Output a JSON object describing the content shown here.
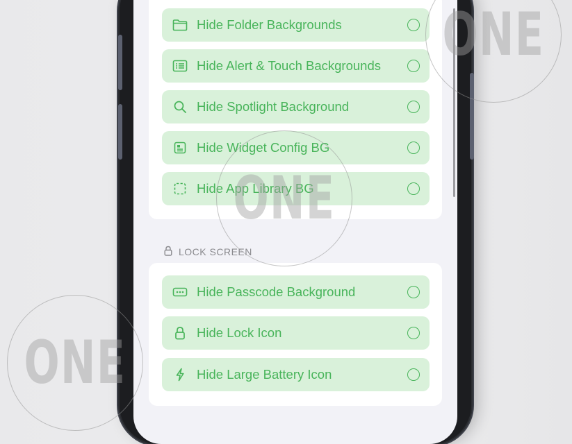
{
  "display_items": [
    {
      "label": "Hide Folder Backgrounds",
      "icon": "folder-icon"
    },
    {
      "label": "Hide Alert & Touch Backgrounds",
      "icon": "alert-list-icon"
    },
    {
      "label": "Hide Spotlight Background",
      "icon": "search-icon"
    },
    {
      "label": "Hide Widget Config BG",
      "icon": "widget-config-icon"
    },
    {
      "label": "Hide App Library BG",
      "icon": "dashed-square-icon"
    }
  ],
  "lock_screen": {
    "title": "LOCK SCREEN",
    "items": [
      {
        "label": "Hide Passcode Background",
        "icon": "passcode-icon"
      },
      {
        "label": "Hide Lock Icon",
        "icon": "lock-icon"
      },
      {
        "label": "Hide Large Battery Icon",
        "icon": "bolt-icon"
      }
    ]
  },
  "watermark": {
    "text": "ONE"
  },
  "colors": {
    "accent": "#48b45a",
    "row_bg": "#d9f1da",
    "screen_bg": "#f2f2f7",
    "header": "#8a8a8e"
  }
}
